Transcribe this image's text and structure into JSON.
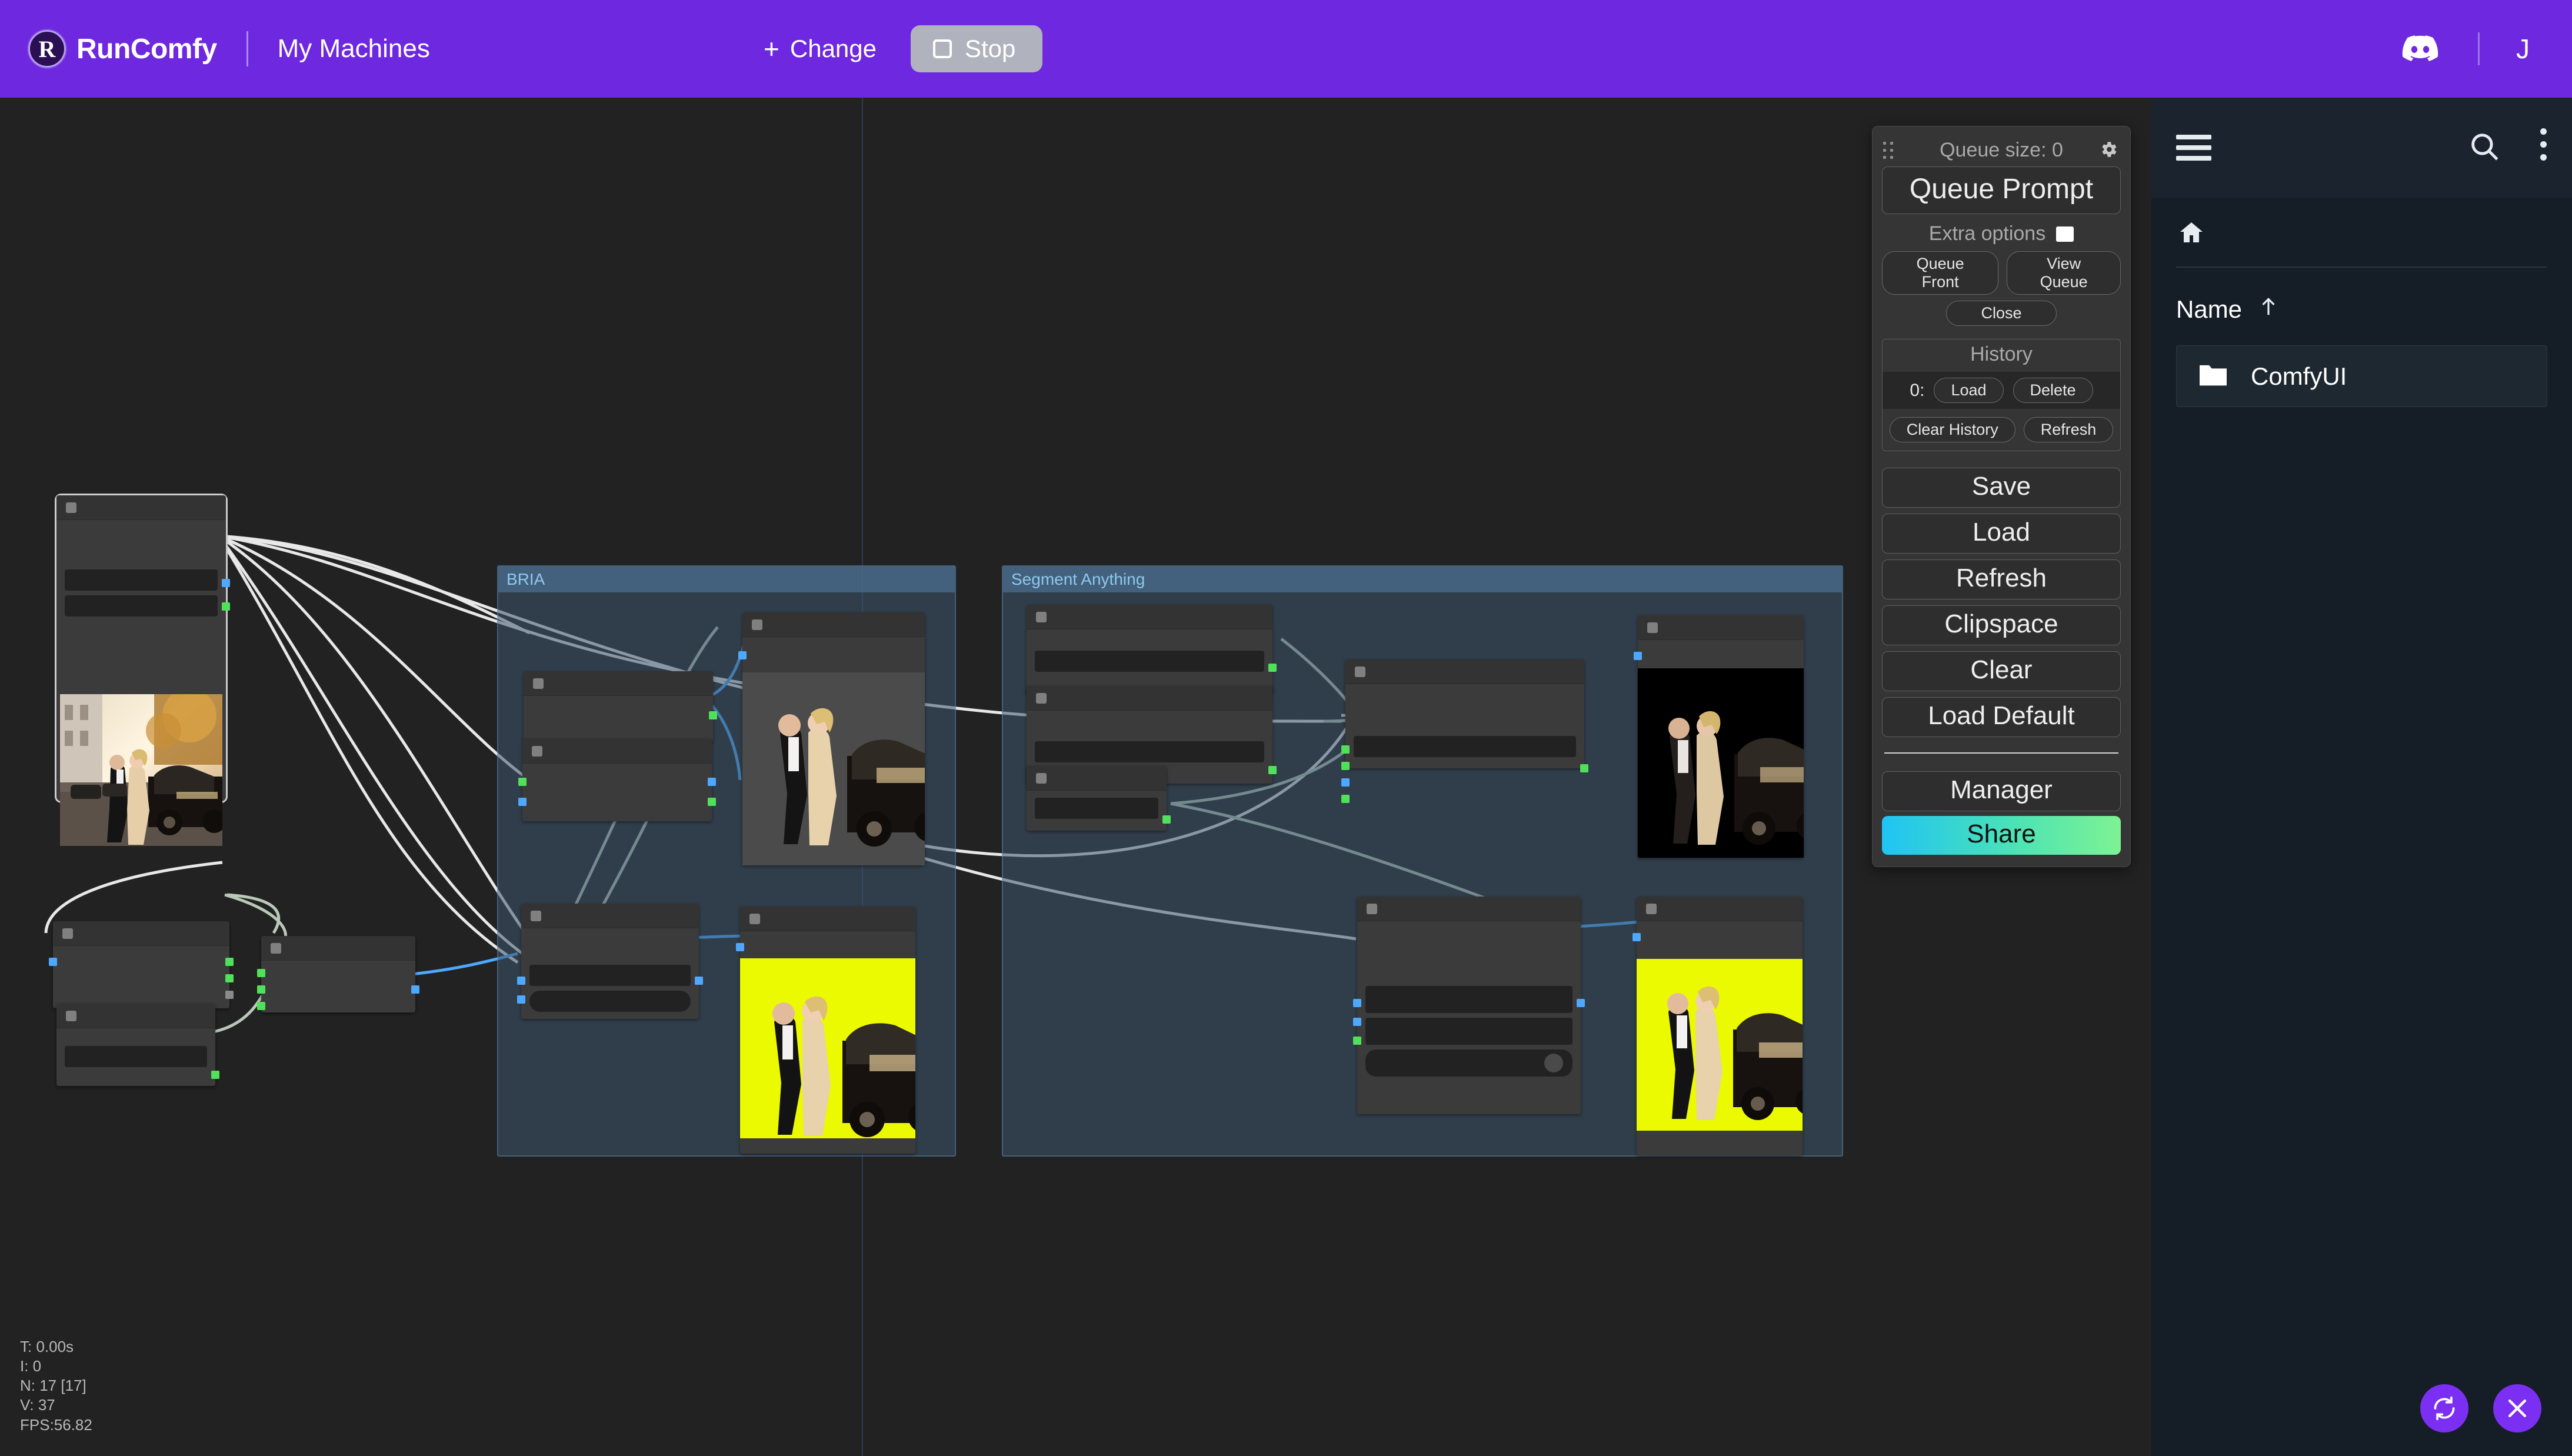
{
  "topbar": {
    "logo_letter": "R",
    "brand": "RunComfy",
    "section": "My Machines",
    "change_label": "Change",
    "change_plus": "+",
    "stop_label": "Stop",
    "discord_icon": "discord-icon",
    "avatar_initial": "J"
  },
  "comfy_menu": {
    "queue_size": "Queue size: 0",
    "queue_prompt": "Queue Prompt",
    "extra_options": "Extra options",
    "queue_front": "Queue Front",
    "view_queue": "View Queue",
    "close": "Close",
    "history_title": "History",
    "history_index": "0:",
    "history_load": "Load",
    "history_delete": "Delete",
    "clear_history": "Clear History",
    "history_refresh": "Refresh",
    "save": "Save",
    "load": "Load",
    "refresh": "Refresh",
    "clipspace": "Clipspace",
    "clear": "Clear",
    "load_default": "Load Default",
    "manager": "Manager",
    "share": "Share",
    "share_gradient_from": "#1fc4f4",
    "share_gradient_to": "#7ef293"
  },
  "sidebar": {
    "menu_icon": "hamburger-icon",
    "search_icon": "search-icon",
    "more_icon": "kebab-icon",
    "home_icon": "home-icon",
    "column_name": "Name",
    "sort_arrow": "↑",
    "files": [
      {
        "name": "ComfyUI",
        "icon": "folder-icon"
      }
    ]
  },
  "canvas": {
    "groups": [
      {
        "title": "BRIA"
      },
      {
        "title": "Segment Anything"
      }
    ],
    "stats": "T: 0.00s\nI: 0\nN: 17 [17]\nV: 37\nFPS:56.82"
  },
  "fabs": [
    {
      "name": "reload-button",
      "icon": "refresh-icon"
    },
    {
      "name": "close-button",
      "icon": "close-icon"
    }
  ]
}
